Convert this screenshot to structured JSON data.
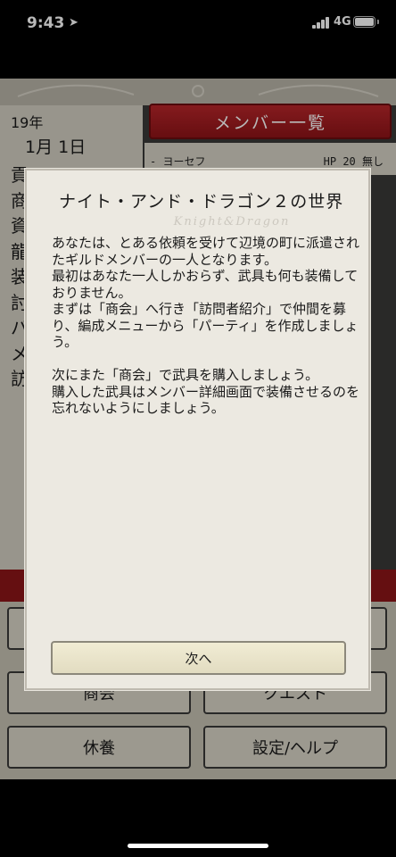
{
  "status_bar": {
    "time": "9:43",
    "network": "4G"
  },
  "date": {
    "year": "19年",
    "month_day": "1月 1日"
  },
  "member_list_button": "メンバー一覧",
  "member": {
    "name": "- ヨーセフ",
    "hp": "HP 20 無し"
  },
  "menu_initials": [
    "貢",
    "商",
    "資",
    "龍",
    "装",
    "討",
    "パ",
    "メ",
    "訪"
  ],
  "commands": [
    "商会",
    "クエスト",
    "休養",
    "設定/ヘルプ"
  ],
  "dialog": {
    "title": "ナイト・アンド・ドラゴン２の世界",
    "watermark_top": "Knight&Dragon",
    "body": "あなたは、とある依頼を受けて辺境の町に派遣されたギルドメンバーの一人となります。\n最初はあなた一人しかおらず、武具も何も装備しておりません。\nまずは「商会」へ行き「訪問者紹介」で仲間を募り、編成メニューから「パーティ」を作成しましょう。\n\n次にまた「商会」で武具を購入しましょう。\n購入した武具はメンバー詳細画面で装備させるのを忘れないようにしましょう。",
    "next_button": "次へ"
  },
  "colors": {
    "accent_red": "#9c1c20",
    "dialog_bg": "#ece9e1"
  }
}
